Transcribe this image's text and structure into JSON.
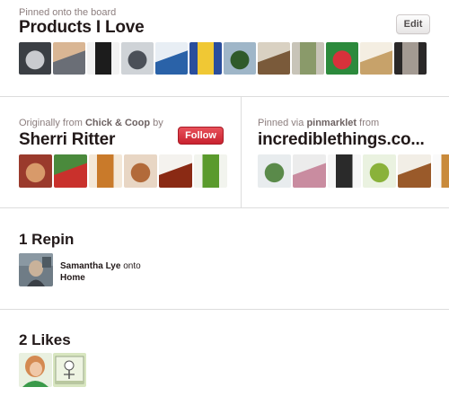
{
  "board": {
    "pinned_onto_label": "Pinned onto the board",
    "name": "Products I Love",
    "edit_label": "Edit",
    "thumbnails": [
      {
        "icon": "scooter-image",
        "colors": [
          "#3b3f44",
          "#c9cbcf"
        ]
      },
      {
        "icon": "hands-image",
        "colors": [
          "#d9b694",
          "#6a6e76"
        ]
      },
      {
        "icon": "bag-image",
        "colors": [
          "#f2f2f2",
          "#1c1c1c"
        ]
      },
      {
        "icon": "device-image",
        "colors": [
          "#cfd3d7",
          "#4b5058"
        ]
      },
      {
        "icon": "webpage-image",
        "colors": [
          "#e8eef4",
          "#2a62a8"
        ]
      },
      {
        "icon": "magazine-image",
        "colors": [
          "#2a4e9c",
          "#f0c834"
        ]
      },
      {
        "icon": "waterfall-image",
        "colors": [
          "#9fb6c8",
          "#2f5a2a"
        ]
      },
      {
        "icon": "shelf-image",
        "colors": [
          "#d9d1c2",
          "#7a5a3a"
        ]
      },
      {
        "icon": "boots-image",
        "colors": [
          "#c8c4b8",
          "#8a9a6a"
        ]
      },
      {
        "icon": "gift-image",
        "colors": [
          "#2c8a3c",
          "#d8313b"
        ]
      },
      {
        "icon": "lamp-image",
        "colors": [
          "#f4eee2",
          "#c7a26a"
        ]
      },
      {
        "icon": "portrait-image",
        "colors": [
          "#2a2828",
          "#a39a92"
        ]
      }
    ]
  },
  "origin": {
    "prefix": "Originally from",
    "source": "Chick & Coop",
    "by": "by",
    "author": "Sherri Ritter",
    "follow_label": "Follow",
    "thumbnails": [
      {
        "icon": "produce-image",
        "colors": [
          "#9a3a2c",
          "#d89a6a"
        ]
      },
      {
        "icon": "greens-image",
        "colors": [
          "#4a8a3c",
          "#c9312c"
        ]
      },
      {
        "icon": "pastry-image",
        "colors": [
          "#f4e8d8",
          "#c97a2a"
        ]
      },
      {
        "icon": "skewers-image",
        "colors": [
          "#e8d6c4",
          "#b26a3a"
        ]
      },
      {
        "icon": "bottles-image",
        "colors": [
          "#f4f2ee",
          "#8a2a14"
        ]
      },
      {
        "icon": "salad-image",
        "colors": [
          "#f2f4ee",
          "#5a9a2c"
        ]
      }
    ]
  },
  "via": {
    "prefix": "Pinned via",
    "tool": "pinmarklet",
    "suffix": "from",
    "site": "incrediblethings.co...",
    "thumbnails": [
      {
        "icon": "gadget-image",
        "colors": [
          "#e8ecee",
          "#5a8a4a"
        ]
      },
      {
        "icon": "pink-item-image",
        "colors": [
          "#ececec",
          "#c98ca0"
        ]
      },
      {
        "icon": "mug-image",
        "colors": [
          "#f6f6f6",
          "#2a2a2a"
        ]
      },
      {
        "icon": "cup-image",
        "colors": [
          "#eaf2e0",
          "#8ab23a"
        ]
      },
      {
        "icon": "violins-image",
        "colors": [
          "#f2eee6",
          "#9a5a2a"
        ]
      },
      {
        "icon": "cable-image",
        "colors": [
          "#fafafa",
          "#c98a3a"
        ]
      }
    ]
  },
  "repins": {
    "title": "1 Repin",
    "user": "Samantha Lye",
    "connector": "onto",
    "board": "Home"
  },
  "likes": {
    "title": "2 Likes"
  }
}
